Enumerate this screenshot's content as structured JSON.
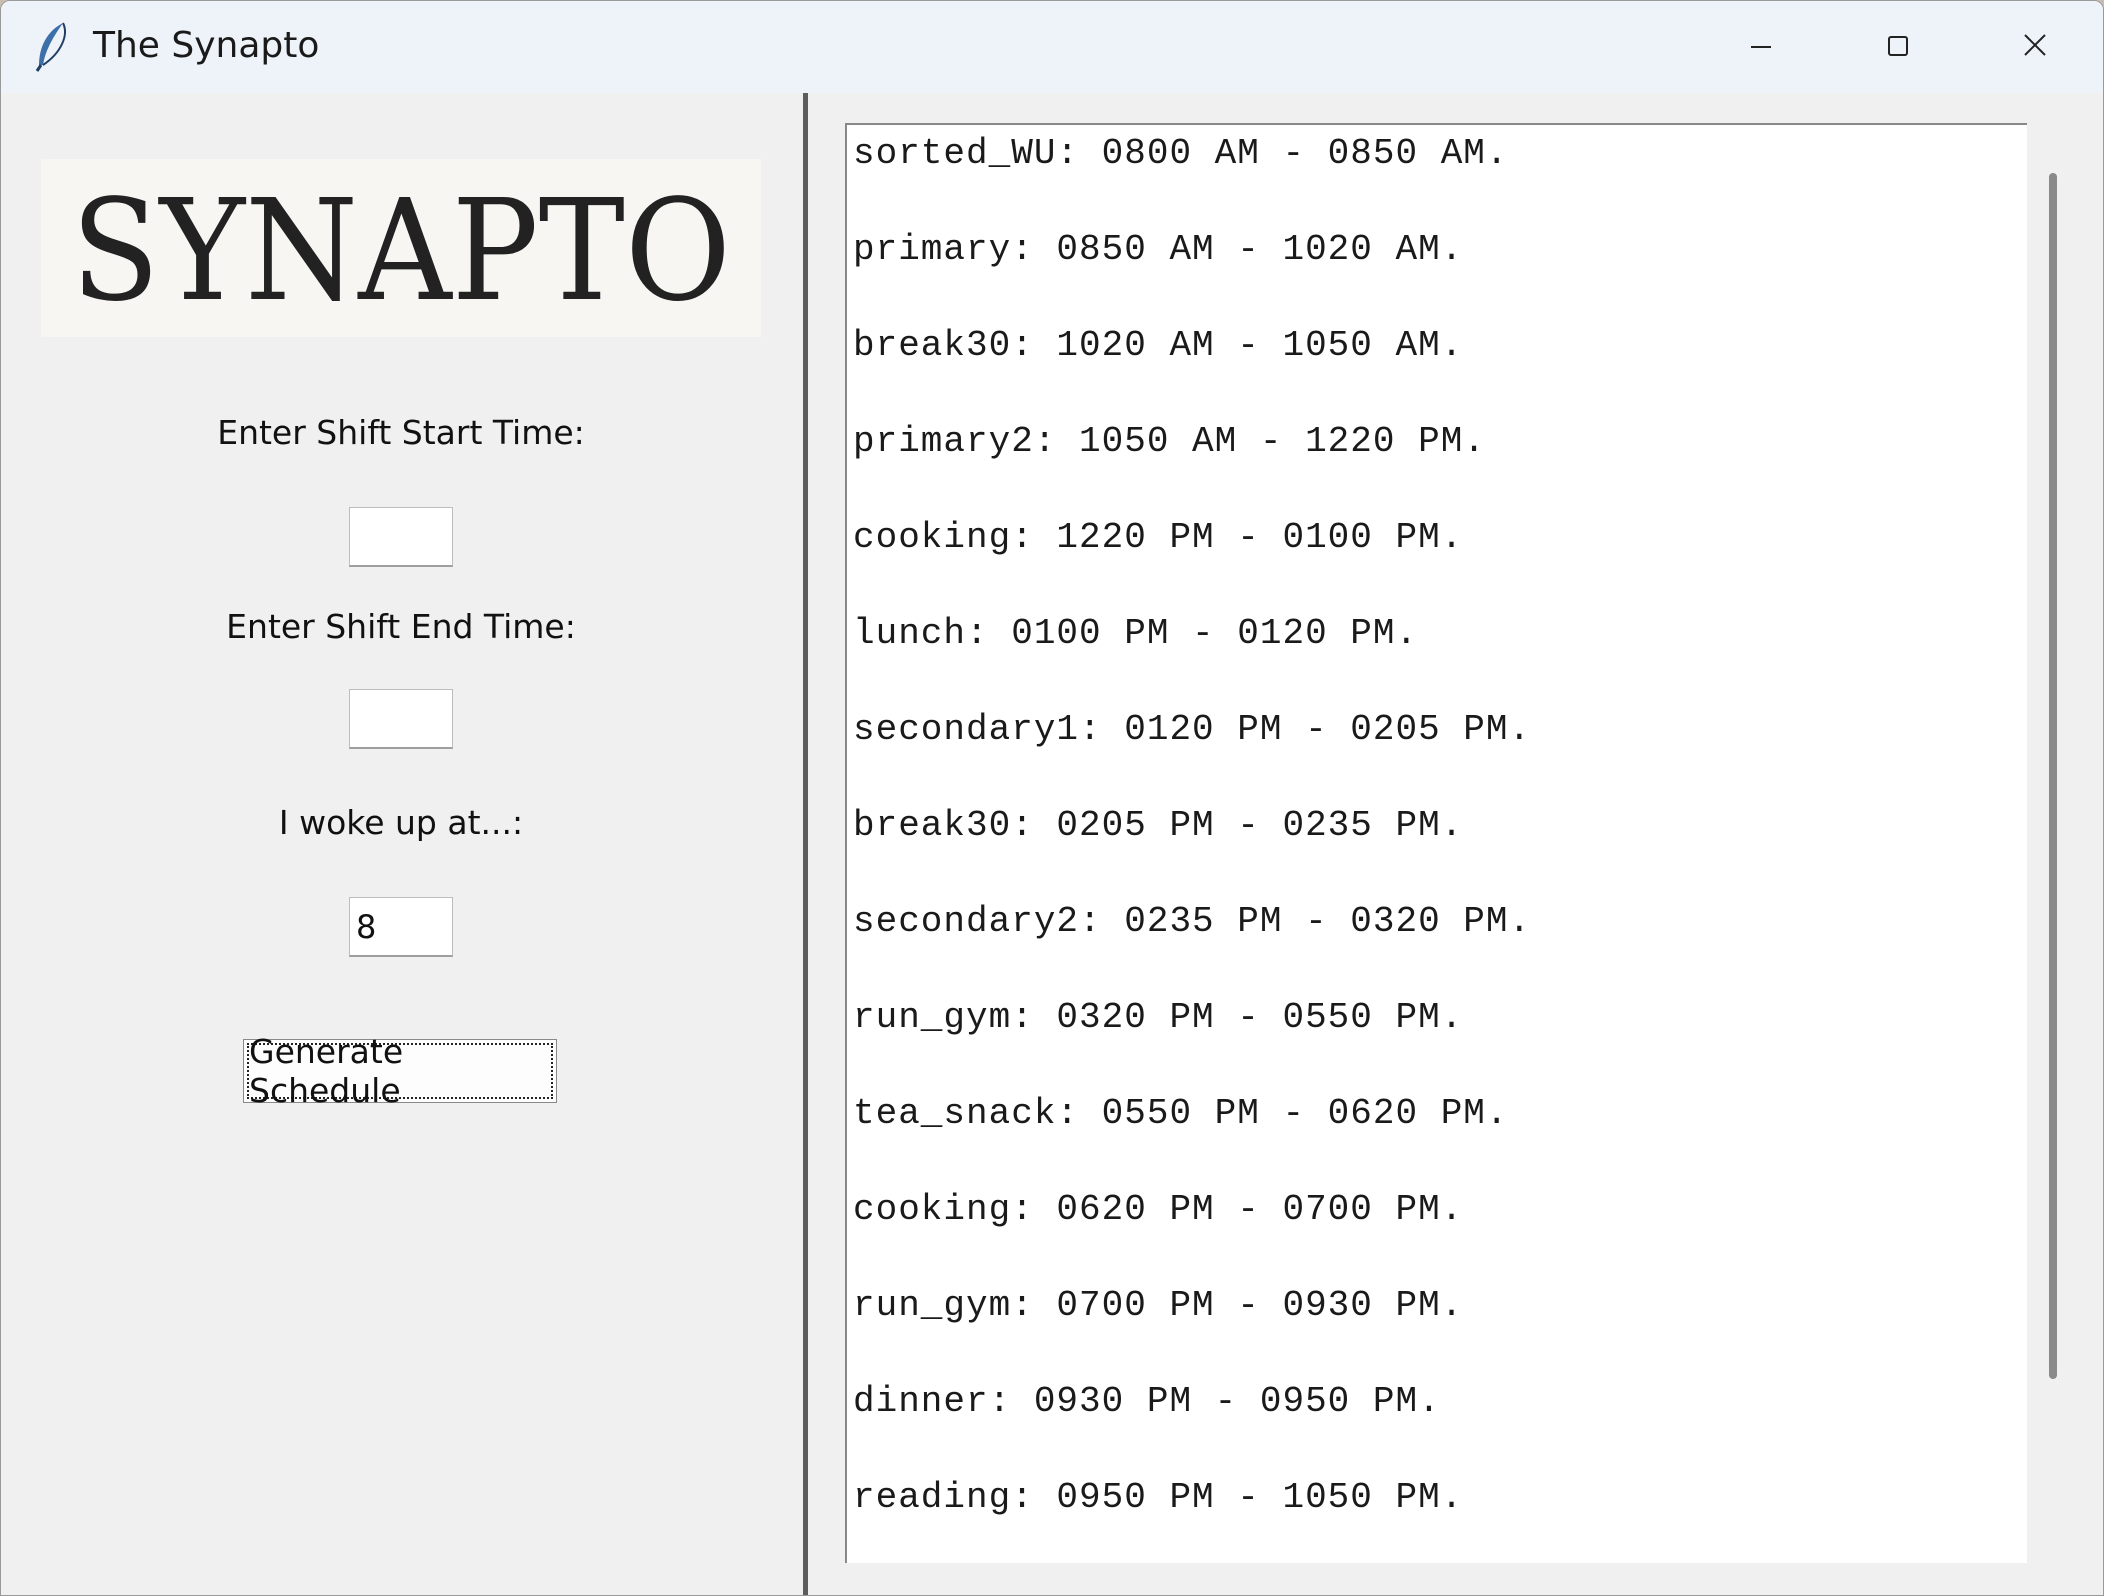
{
  "window": {
    "title": "The Synapto"
  },
  "titlebar": {
    "icon": "feather-icon",
    "controls": [
      "minimize-icon",
      "maximize-icon",
      "close-icon"
    ]
  },
  "logo": {
    "text": "SYNAPTO"
  },
  "form": {
    "start_label": "Enter Shift Start Time:",
    "start_value": "",
    "end_label": "Enter Shift End Time:",
    "end_value": "",
    "woke_label": "I woke up at...:",
    "woke_value": "8",
    "generate_label": "Generate Schedule"
  },
  "schedule": {
    "lines": [
      "sorted_WU: 0800 AM - 0850 AM.",
      "primary: 0850 AM - 1020 AM.",
      "break30: 1020 AM - 1050 AM.",
      "primary2: 1050 AM - 1220 PM.",
      "cooking: 1220 PM - 0100 PM.",
      "lunch: 0100 PM - 0120 PM.",
      "secondary1: 0120 PM - 0205 PM.",
      "break30: 0205 PM - 0235 PM.",
      "secondary2: 0235 PM - 0320 PM.",
      "run_gym: 0320 PM - 0550 PM.",
      "tea_snack: 0550 PM - 0620 PM.",
      "cooking: 0620 PM - 0700 PM.",
      "run_gym: 0700 PM - 0930 PM.",
      "dinner: 0930 PM - 0950 PM.",
      "reading: 0950 PM - 1050 PM."
    ]
  }
}
